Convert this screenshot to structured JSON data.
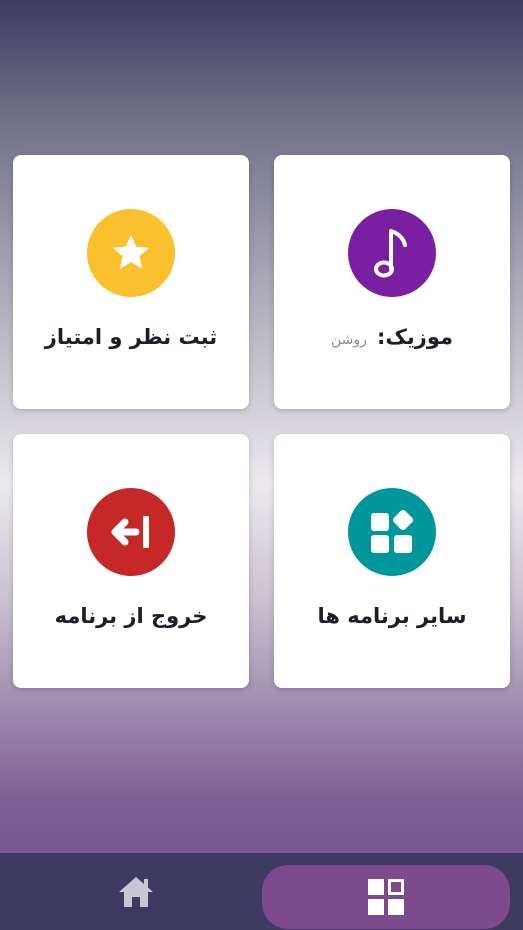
{
  "cards": {
    "rate": {
      "label": "ثبت نظر و امتیاز",
      "icon": "star-icon",
      "color": "#fbc02d"
    },
    "music": {
      "label": "موزیک:",
      "status": "روشن",
      "icon": "music-note-icon",
      "color": "#7b1fa2"
    },
    "exit": {
      "label": "خروج از برنامه",
      "icon": "exit-arrow-icon",
      "color": "#c62828"
    },
    "apps": {
      "label": "سایر برنامه ها",
      "icon": "apps-grid-icon",
      "color": "#00979c"
    }
  },
  "bottom_nav": {
    "items": [
      {
        "icon": "home-icon",
        "active": false
      },
      {
        "icon": "dashboard-icon",
        "active": true
      }
    ],
    "bar_color": "#3e3a62",
    "active_color": "#7e4a8e"
  }
}
